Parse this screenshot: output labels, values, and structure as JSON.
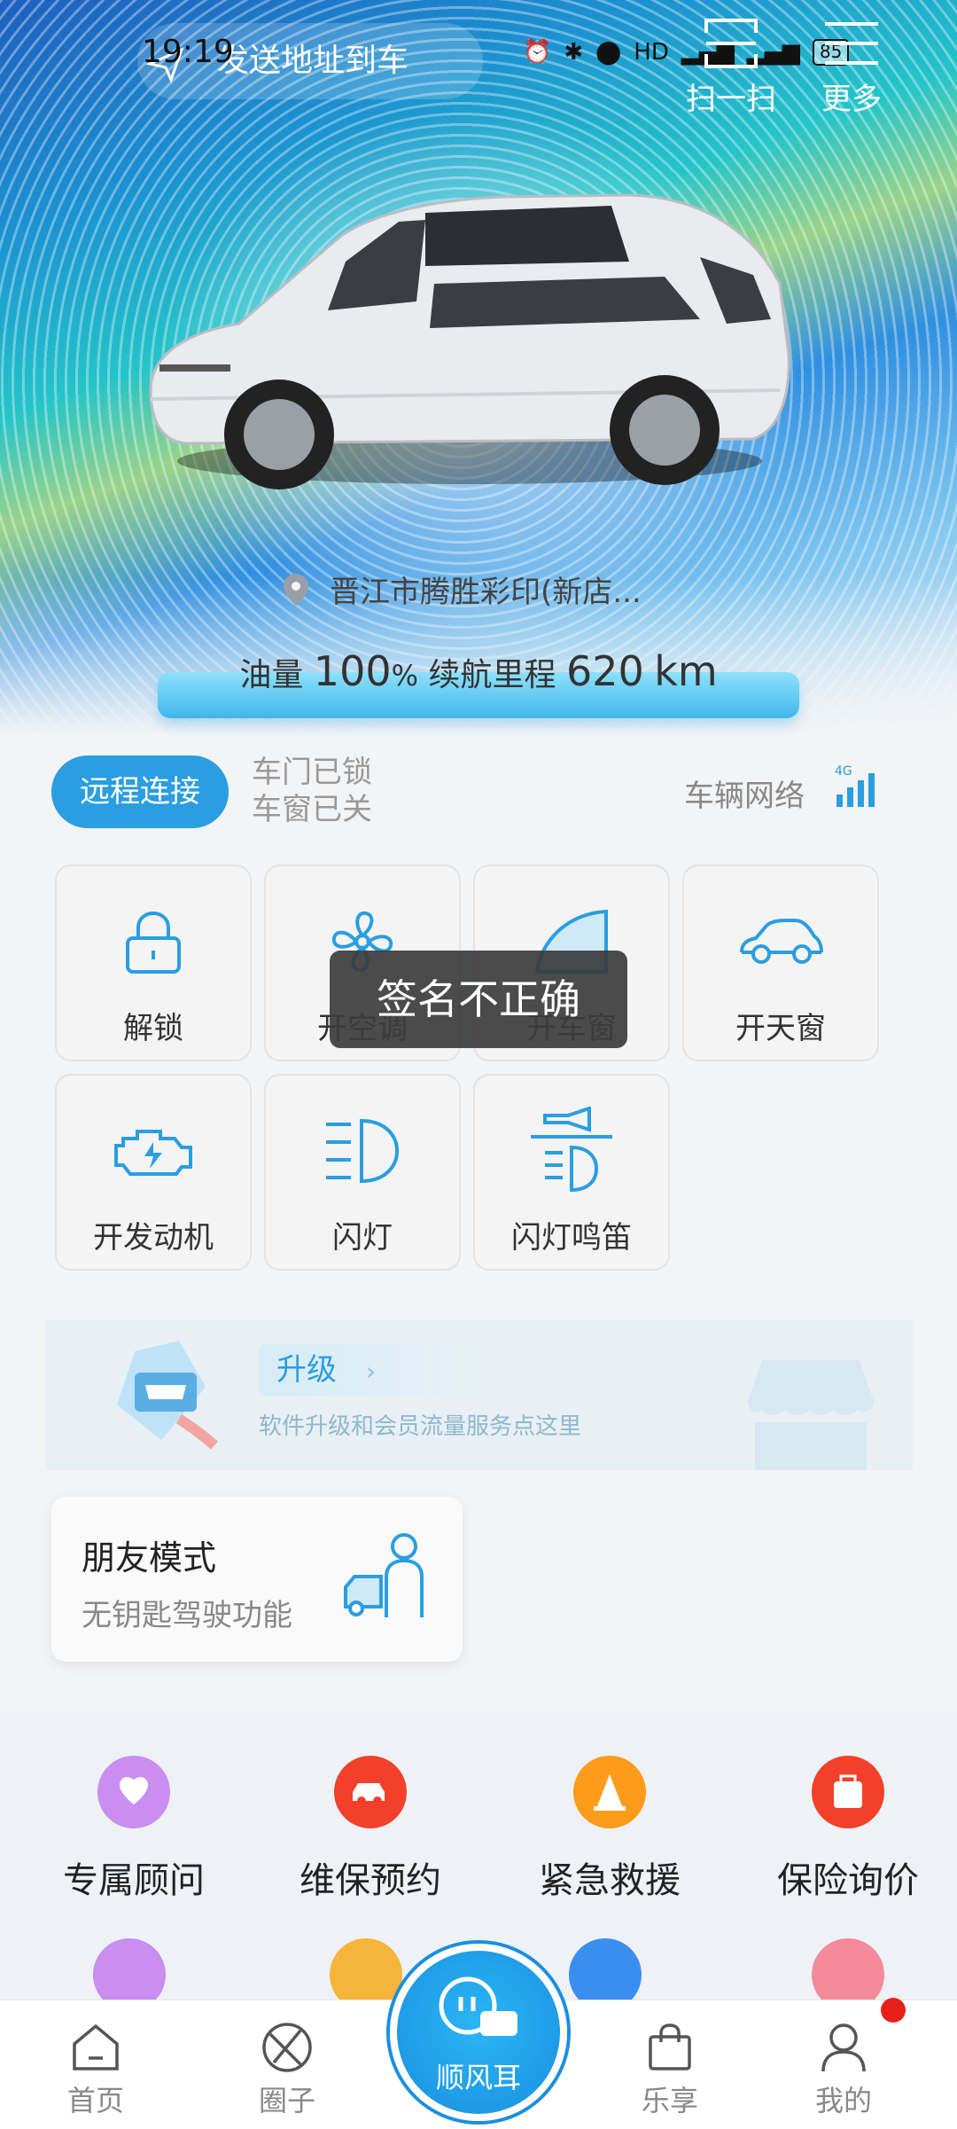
{
  "status_bar": {
    "time": "19:19",
    "battery": "85"
  },
  "header": {
    "send_address": "发送地址到车",
    "scan_label": "扫一扫",
    "more_label": "更多"
  },
  "vehicle": {
    "location": "晋江市腾胜彩印(新店...",
    "fuel_label": "油量",
    "fuel_value": "100",
    "fuel_unit": "%",
    "range_label": "续航里程",
    "range_value": "620",
    "range_unit": "km"
  },
  "connection": {
    "remote_button": "远程连接",
    "door_status": "车门已锁",
    "window_status": "车窗已关",
    "network_label": "车辆网络",
    "network_type": "4G"
  },
  "controls": [
    {
      "label": "解锁",
      "icon": "lock-icon"
    },
    {
      "label": "开空调",
      "icon": "fan-icon"
    },
    {
      "label": "开车窗",
      "icon": "window-icon"
    },
    {
      "label": "开天窗",
      "icon": "car-icon"
    },
    {
      "label": "开发动机",
      "icon": "engine-icon"
    },
    {
      "label": "闪灯",
      "icon": "headlight-icon"
    },
    {
      "label": "闪灯鸣笛",
      "icon": "horn-icon"
    }
  ],
  "toast": "签名不正确",
  "upgrade": {
    "title": "升级",
    "subtitle": "软件升级和会员流量服务点这里"
  },
  "friend_mode": {
    "title": "朋友模式",
    "subtitle": "无钥匙驾驶功能"
  },
  "services": [
    {
      "label": "专属顾问",
      "color": "#c98ef0"
    },
    {
      "label": "维保预约",
      "color": "#f2402a"
    },
    {
      "label": "紧急救援",
      "color": "#ff9b1a"
    },
    {
      "label": "保险询价",
      "color": "#f2402a"
    }
  ],
  "services_row2_colors": [
    "#c98ef0",
    "#f4b53a",
    "#3a8ef0",
    "#f58b9a"
  ],
  "tabbar": {
    "home": "首页",
    "circle": "圈子",
    "center": "顺风耳",
    "shop": "乐享",
    "mine": "我的"
  },
  "colors": {
    "accent": "#2a9ee0",
    "alert_dot": "#e8201a"
  }
}
